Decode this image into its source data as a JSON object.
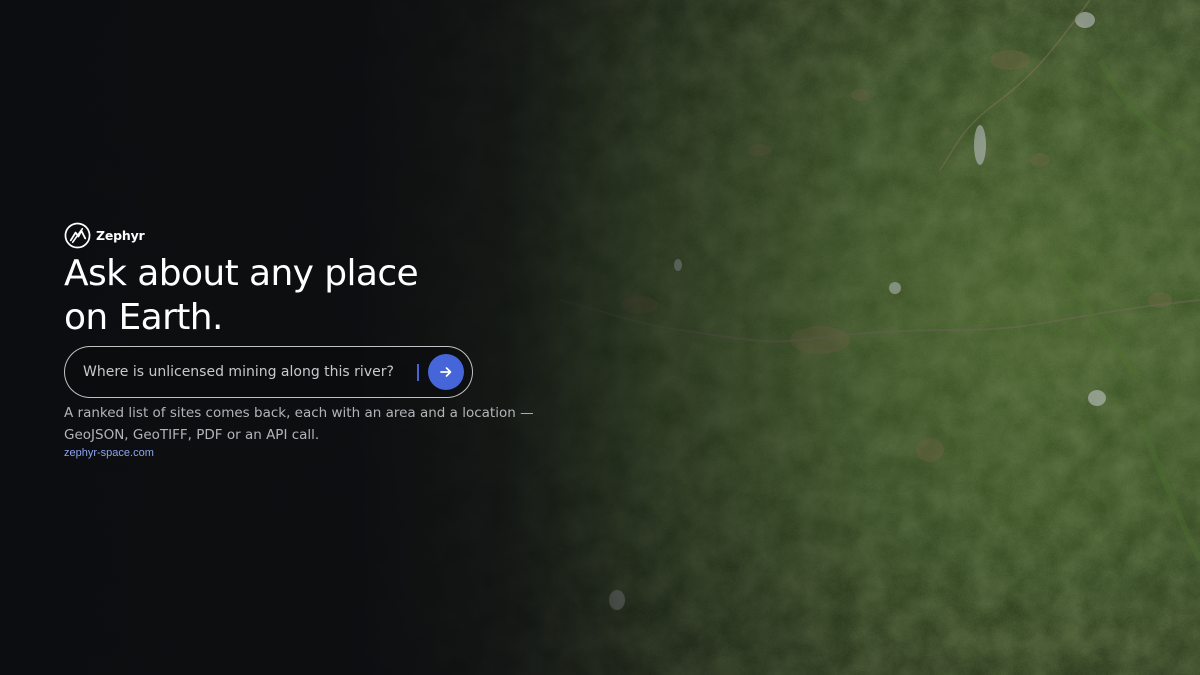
{
  "brand": {
    "name": "Zephyr",
    "logo_icon": "zephyr-logo-icon"
  },
  "hero": {
    "headline_line1": "Ask about any place",
    "headline_line2": "on Earth."
  },
  "search": {
    "placeholder": "Where is unlicensed mining along this river?",
    "value": "",
    "submit_icon": "arrow-right-icon",
    "submit_color": "#4565d8"
  },
  "description": {
    "line1": "A ranked list of sites comes back, each with an area and a location —",
    "line2": "GeoJSON, GeoTIFF, PDF or an API call."
  },
  "footer": {
    "link_text": "zephyr-space.com"
  },
  "background": {
    "type": "satellite-imagery",
    "base_color": "#0c0d10",
    "terrain_color": "#2f4a1c"
  }
}
